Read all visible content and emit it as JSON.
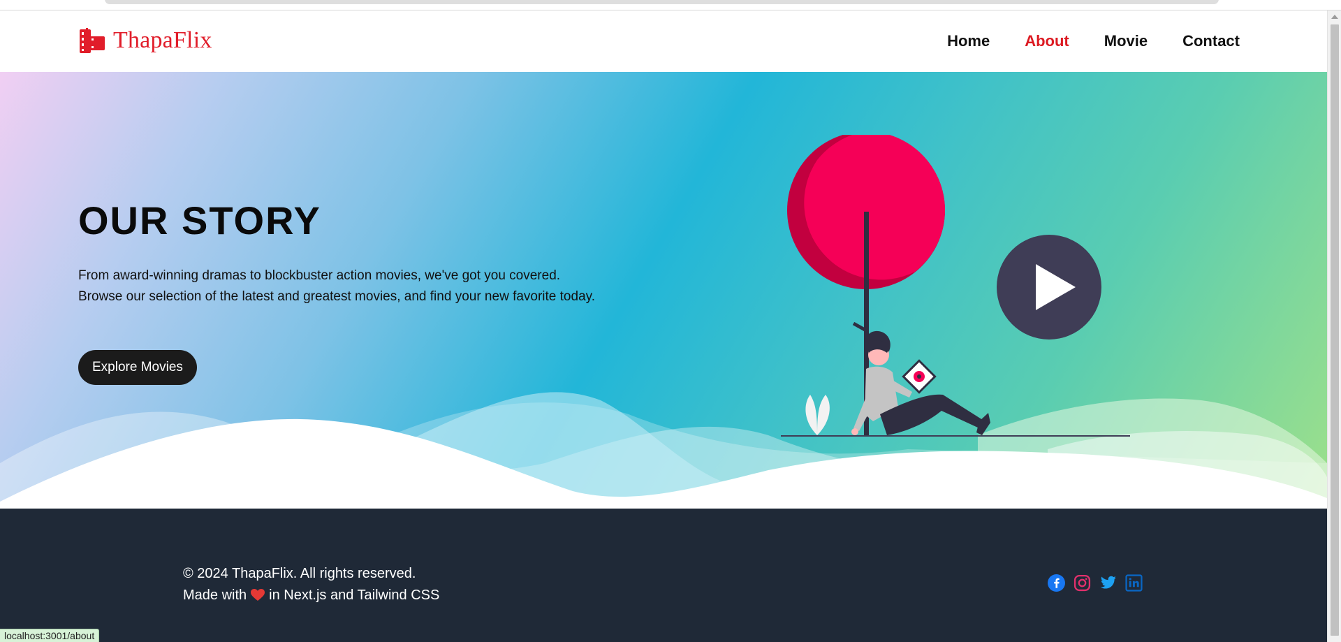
{
  "brand": {
    "name": "ThapaFlix",
    "color": "#e11d2a"
  },
  "nav": {
    "items": [
      {
        "label": "Home",
        "active": false
      },
      {
        "label": "About",
        "active": true
      },
      {
        "label": "Movie",
        "active": false
      },
      {
        "label": "Contact",
        "active": false
      }
    ],
    "active_color": "#dc1a22"
  },
  "hero": {
    "title": "OUR STORY",
    "description_line1": "From award-winning dramas to blockbuster action movies, we've got you covered.",
    "description_line2": "Browse our selection of the latest and greatest movies, and find your new favorite today.",
    "cta_label": "Explore Movies",
    "illustration_icons": [
      "tree-illustration",
      "reading-woman-illustration",
      "play-button-icon"
    ]
  },
  "footer": {
    "copyright": "© 2024 ThapaFlix. All rights reserved.",
    "made_with_prefix": "Made with",
    "made_with_suffix": "in Next.js and Tailwind CSS",
    "socials": [
      "facebook-icon",
      "instagram-icon",
      "twitter-icon",
      "linkedin-icon"
    ]
  },
  "status_bar": {
    "url": "localhost:3001/about"
  },
  "colors": {
    "footer_bg": "#1f2937",
    "button_bg": "#1b1b1b",
    "accent_pink": "#f50057"
  }
}
